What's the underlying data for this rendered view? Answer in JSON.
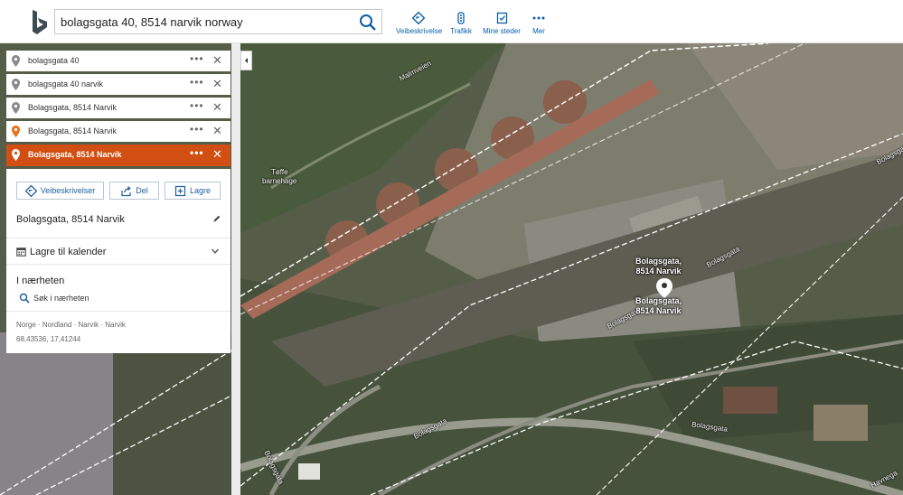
{
  "search": {
    "query": "bolagsgata 40, 8514 narvik norway"
  },
  "toolbar": {
    "items": [
      {
        "label": "Veibeskrivelse",
        "icon": "directions-icon"
      },
      {
        "label": "Trafikk",
        "icon": "traffic-icon"
      },
      {
        "label": "Mine steder",
        "icon": "my-places-icon"
      },
      {
        "label": "Mer",
        "icon": "more-dots-icon"
      }
    ]
  },
  "history": [
    {
      "label": "bolagsgata 40",
      "pin_color": "#8a8a8a"
    },
    {
      "label": "bolagsgata 40 narvik",
      "pin_color": "#8a8a8a"
    },
    {
      "label": "Bolagsgata, 8514 Narvik",
      "pin_color": "#8a8a8a"
    },
    {
      "label": "Bolagsgata, 8514 Narvik",
      "pin_color": "#e8701a"
    }
  ],
  "active_item": {
    "label": "Bolagsgata, 8514 Narvik"
  },
  "card": {
    "actions": {
      "directions": "Veibeskrivelser",
      "share": "Del",
      "save": "Lagre"
    },
    "title": "Bolagsgata, 8514 Narvik",
    "calendar": "Lagre til kalender",
    "nearby_heading": "I nærheten",
    "nearby_search": "Søk i nærheten",
    "breadcrumb": "Norge · Nordland · Narvik · Narvik",
    "coordinates": "68,43536, 17,41244"
  },
  "map": {
    "labels": {
      "malmveien": "Malmveien",
      "toffe_1": "Tøffe",
      "toffe_2": "barnehage",
      "bolagsgata_1": "Bolagsgata",
      "bolagsgata_2": "Bolagsgata",
      "bolagsgata_3": "Bolagsgata",
      "bolagsgata_4": "Bolagsgata",
      "bolagsgata_5": "Bolagsgata",
      "havnegata": "Havnega"
    },
    "pin_label_top_1": "Bolagsgata,",
    "pin_label_top_2": "8514 Narvik",
    "pin_label_bottom_1": "Bolagsgata,",
    "pin_label_bottom_2": "8514 Narvik"
  },
  "colors": {
    "accent": "#d14f12",
    "link": "#1b5f9e",
    "toolbar_blue": "#0a5fa8"
  }
}
